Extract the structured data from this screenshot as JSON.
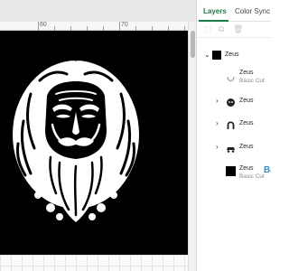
{
  "ruler": {
    "labels": [
      "60",
      "70"
    ]
  },
  "layers_panel": {
    "tabs": [
      {
        "label": "Layers",
        "active": true
      },
      {
        "label": "Color Sync",
        "active": false
      }
    ],
    "toolbar_icons": [
      "group-icon",
      "ungroup-icon",
      "delete-icon"
    ],
    "group": {
      "name": "Zeus"
    },
    "items": [
      {
        "name": "Zeus",
        "type": "Basic Cut",
        "icon": "arc-shape-icon"
      },
      {
        "name": "Zeus",
        "icon": "face-shape-icon"
      },
      {
        "name": "Zeus",
        "icon": "horseshoe-shape-icon"
      },
      {
        "name": "Zeus",
        "icon": "car-shape-icon"
      },
      {
        "name": "Zeus",
        "type": "Basic Cut",
        "icon": "black-square-icon"
      }
    ],
    "edge_peek_text": "Ba"
  },
  "colors": {
    "accent": "#1d7a44",
    "canvas_bg": "#000000",
    "art": "#ffffff"
  }
}
